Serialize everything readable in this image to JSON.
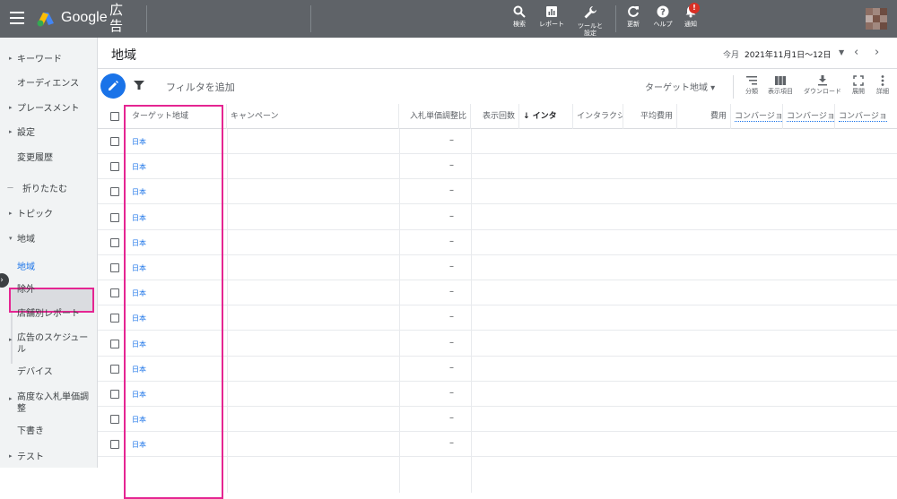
{
  "header": {
    "brand": "Google",
    "brand_ad": "広告",
    "tools": [
      {
        "label": "検索",
        "icon": "search-icon"
      },
      {
        "label": "レポート",
        "icon": "report-icon"
      },
      {
        "label": "ツールと設定",
        "icon": "wrench-icon"
      },
      {
        "label": "更新",
        "icon": "refresh-icon"
      },
      {
        "label": "ヘルプ",
        "icon": "help-icon"
      },
      {
        "label": "通知",
        "icon": "bell-icon"
      }
    ],
    "notification_badge": "!"
  },
  "sidebar": {
    "items": [
      {
        "label": "キーワード",
        "caret": "▸"
      },
      {
        "label": "オーディエンス",
        "caret": ""
      },
      {
        "label": "プレースメント",
        "caret": "▸"
      },
      {
        "label": "設定",
        "caret": "▸"
      },
      {
        "label": "変更履歴",
        "caret": ""
      },
      {
        "label": "折りたたむ",
        "caret": "—"
      },
      {
        "label": "トピック",
        "caret": "▸"
      },
      {
        "label": "地域",
        "caret": "▾"
      },
      {
        "label": "地域",
        "caret": ""
      },
      {
        "label": "除外",
        "caret": ""
      },
      {
        "label": "店舗別レポート",
        "caret": ""
      },
      {
        "label": "広告のスケジュール",
        "caret": "▸"
      },
      {
        "label": "デバイス",
        "caret": ""
      },
      {
        "label": "高度な入札単価調整",
        "caret": "▸"
      },
      {
        "label": "下書き",
        "caret": ""
      },
      {
        "label": "テスト",
        "caret": "▸"
      }
    ]
  },
  "page": {
    "title": "地域",
    "date_prefix": "今月",
    "date_range": "2021年11月1日～12日"
  },
  "toolbar": {
    "filter_label": "フィルタを追加",
    "segment_label": "ターゲット地域 ▾",
    "buttons": [
      {
        "label": "分類",
        "icon": "segment-icon"
      },
      {
        "label": "表示項目",
        "icon": "columns-icon"
      },
      {
        "label": "ダウンロード",
        "icon": "download-icon"
      },
      {
        "label": "展開",
        "icon": "expand-icon"
      },
      {
        "label": "詳細",
        "icon": "more-vert-icon"
      }
    ]
  },
  "table": {
    "columns": [
      "ターゲット地域",
      "キャンペーン",
      "入札単価調整比",
      "表示回数",
      "↓ インタ",
      "インタラクション",
      "平均費用",
      "費用",
      "コンバージョン",
      "コンバージョン",
      "コンバージョ"
    ],
    "rows": [
      {
        "location": "日本",
        "bid_adj": "–"
      },
      {
        "location": "日本",
        "bid_adj": "–"
      },
      {
        "location": "日本",
        "bid_adj": "–"
      },
      {
        "location": "日本",
        "bid_adj": "–"
      },
      {
        "location": "日本",
        "bid_adj": "–"
      },
      {
        "location": "日本",
        "bid_adj": "–"
      },
      {
        "location": "日本",
        "bid_adj": "–"
      },
      {
        "location": "日本",
        "bid_adj": "–"
      },
      {
        "location": "日本",
        "bid_adj": "–"
      },
      {
        "location": "日本",
        "bid_adj": "–"
      },
      {
        "location": "日本",
        "bid_adj": "–"
      },
      {
        "location": "日本",
        "bid_adj": "–"
      },
      {
        "location": "日本",
        "bid_adj": "–"
      }
    ]
  },
  "colors": {
    "topbar": "#5f6368",
    "accent": "#1a73e8",
    "highlight": "#e52592"
  }
}
